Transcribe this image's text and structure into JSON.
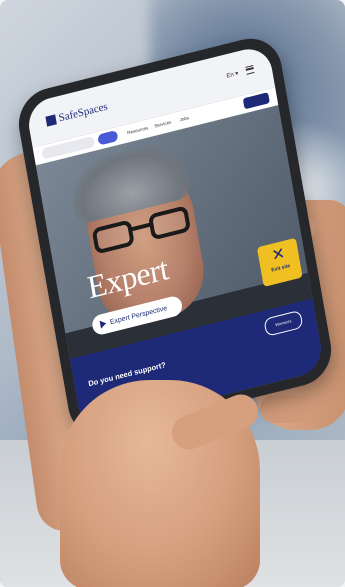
{
  "site": {
    "logo_text": "SafeSpaces",
    "language": "En ▾"
  },
  "nav": {
    "links": [
      "Resources",
      "Services",
      "Jobs"
    ]
  },
  "hero": {
    "title": "Expert",
    "play_label": "Expert Perspective"
  },
  "exit": {
    "label": "Exit site",
    "icon": "close-icon",
    "color": "#f0c023"
  },
  "support": {
    "question": "Do you need support?",
    "badge_text": "Women's"
  },
  "colors": {
    "brand": "#1e2a78",
    "accent": "#4a59d6",
    "exit": "#f0c023"
  }
}
